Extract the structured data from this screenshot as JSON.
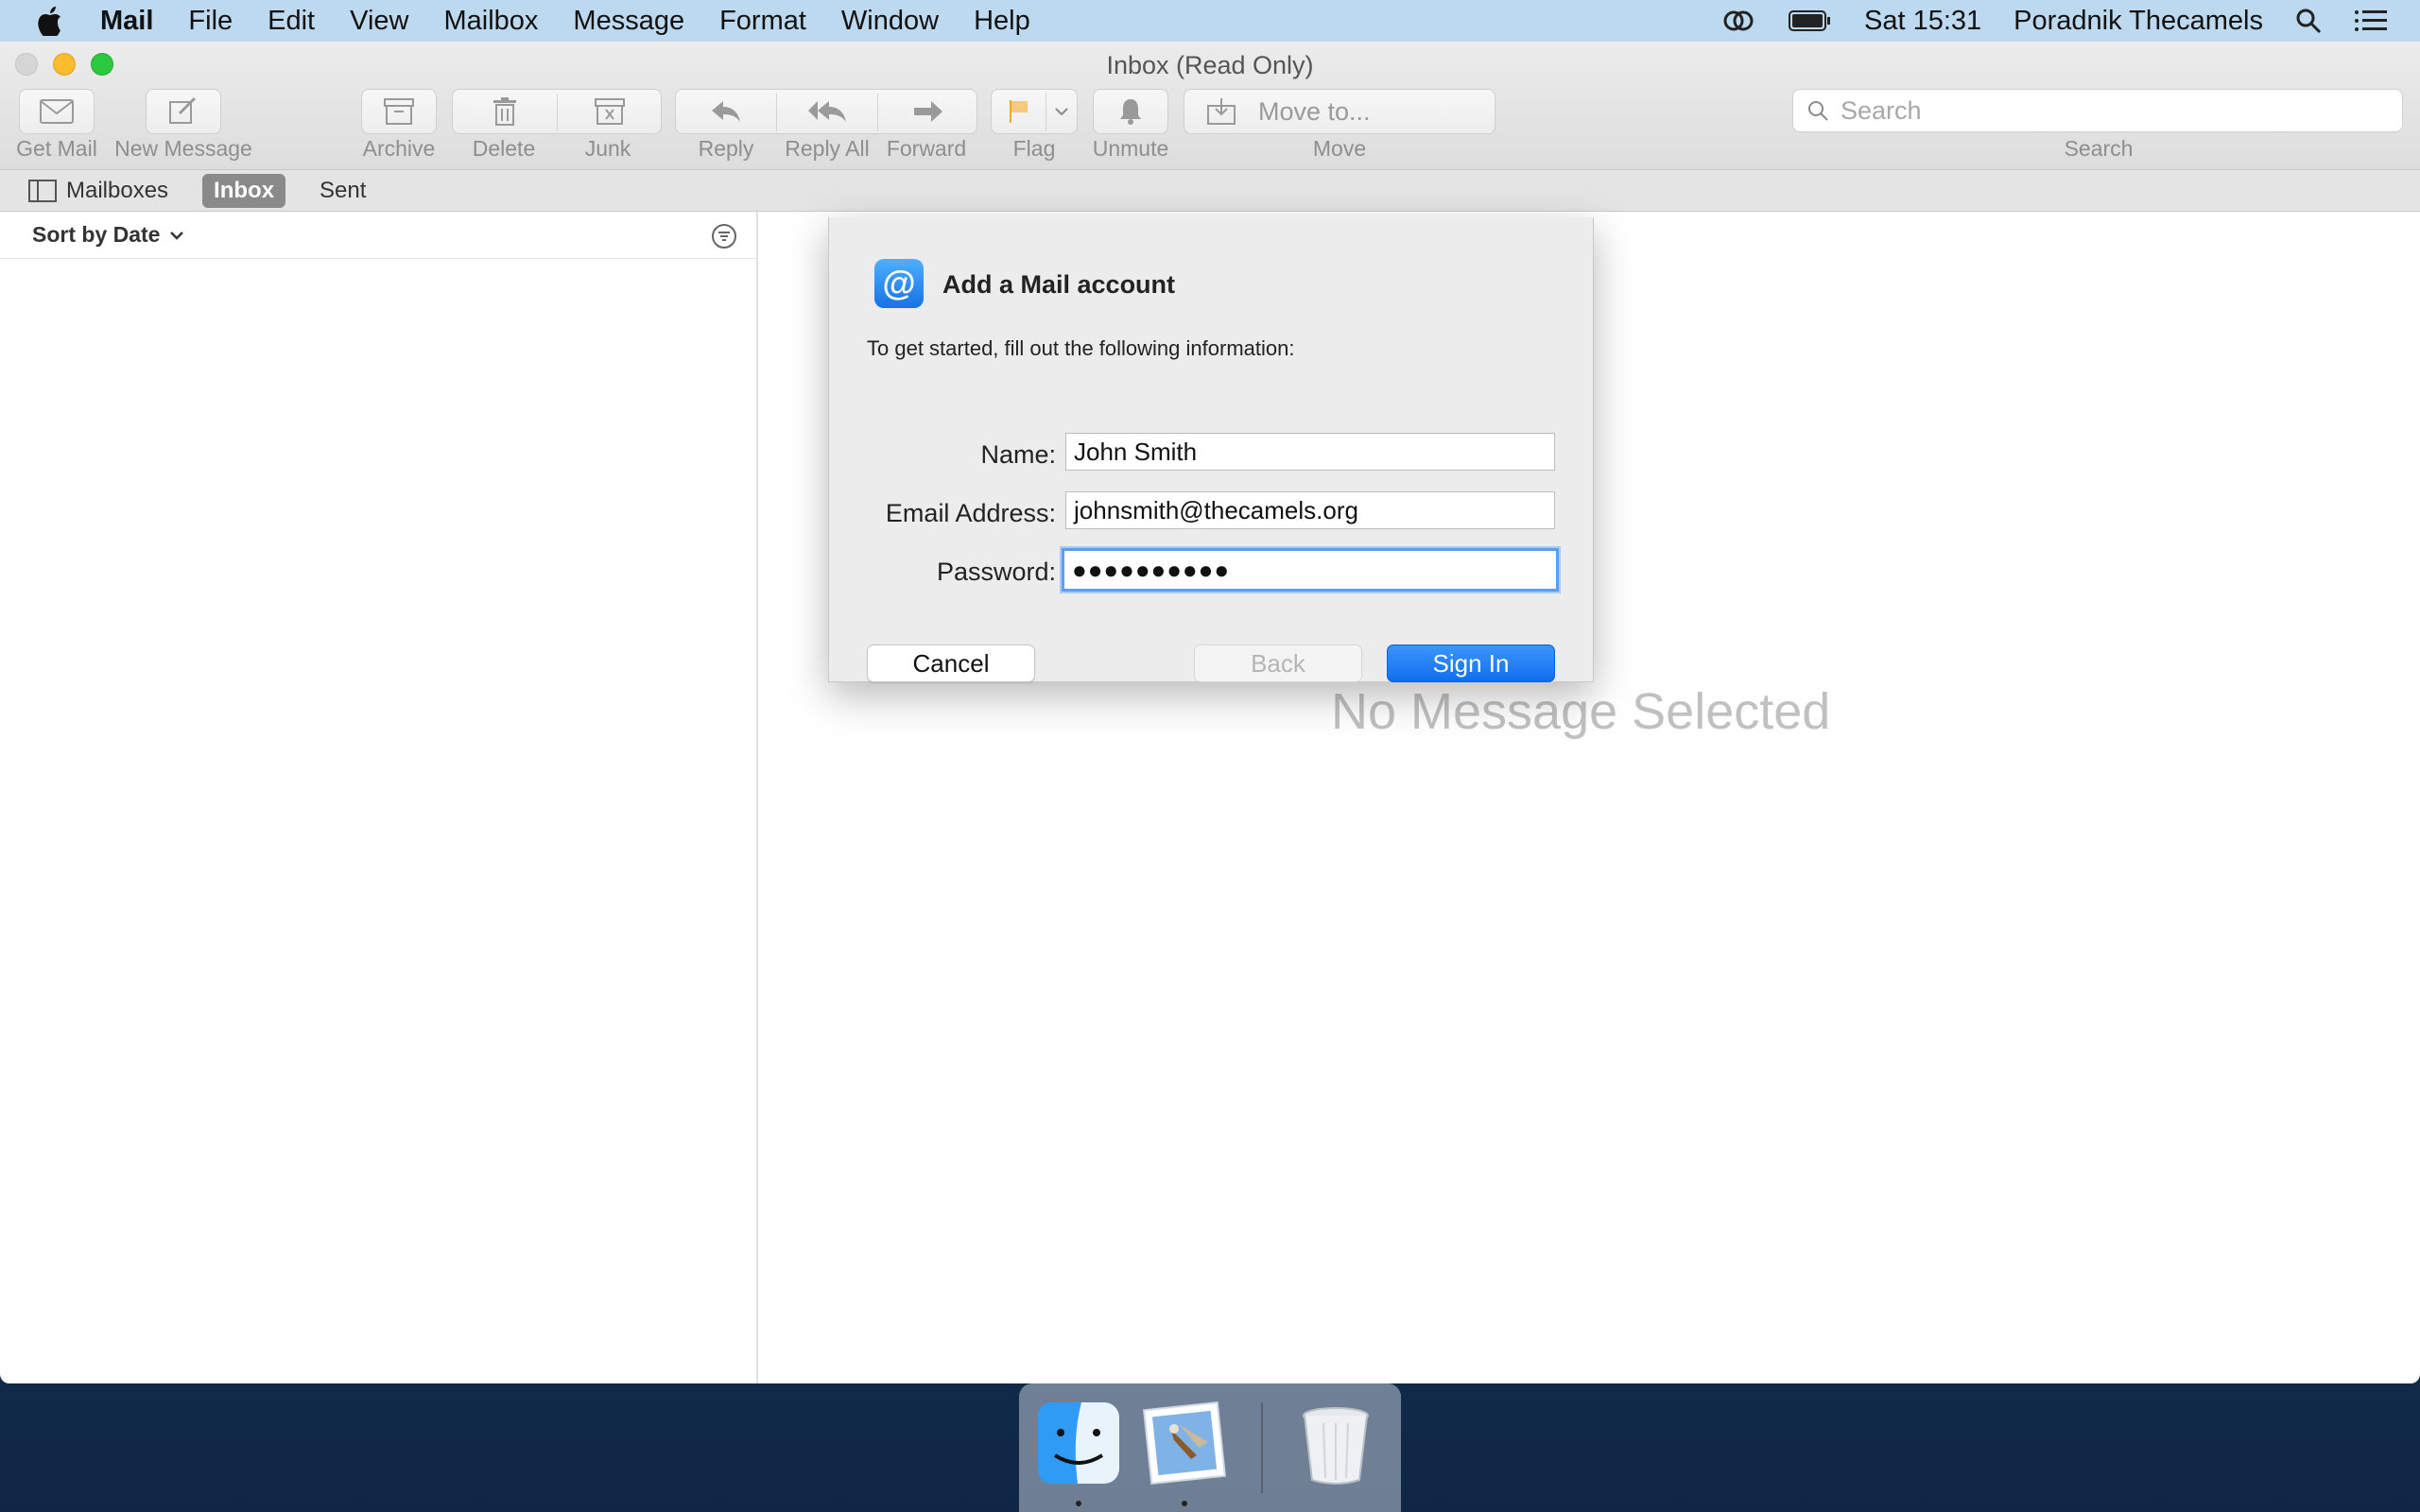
{
  "menubar": {
    "apple": "apple-icon",
    "items": [
      "Mail",
      "File",
      "Edit",
      "View",
      "Mailbox",
      "Message",
      "Format",
      "Window",
      "Help"
    ],
    "clock": "Sat 15:31",
    "user": "Poradnik Thecamels"
  },
  "window": {
    "title": "Inbox (Read Only)"
  },
  "toolbar": {
    "get_mail": "Get Mail",
    "new_message": "New Message",
    "archive": "Archive",
    "delete": "Delete",
    "junk": "Junk",
    "reply": "Reply",
    "reply_all": "Reply All",
    "forward": "Forward",
    "flag": "Flag",
    "unmute": "Unmute",
    "move_to_placeholder": "Move to...",
    "move": "Move",
    "search_placeholder": "Search",
    "search_label": "Search",
    "flag_color": "#f5a623"
  },
  "favorites": {
    "mailboxes": "Mailboxes",
    "inbox": "Inbox",
    "sent": "Sent"
  },
  "message_list": {
    "sort_label": "Sort by Date"
  },
  "viewer": {
    "empty_text": "No Message Selected"
  },
  "dialog": {
    "title": "Add a Mail account",
    "subtitle": "To get started, fill out the following information:",
    "name_label": "Name:",
    "name_value": "John Smith",
    "email_label": "Email Address:",
    "email_value": "johnsmith@thecamels.org",
    "password_label": "Password:",
    "password_value": "●●●●●●●●●●",
    "cancel_label": "Cancel",
    "back_label": "Back",
    "signin_label": "Sign In",
    "accent_color": "#1a73e8"
  },
  "dock": {
    "items": [
      "finder-icon",
      "mail-icon",
      "trash-icon"
    ]
  }
}
